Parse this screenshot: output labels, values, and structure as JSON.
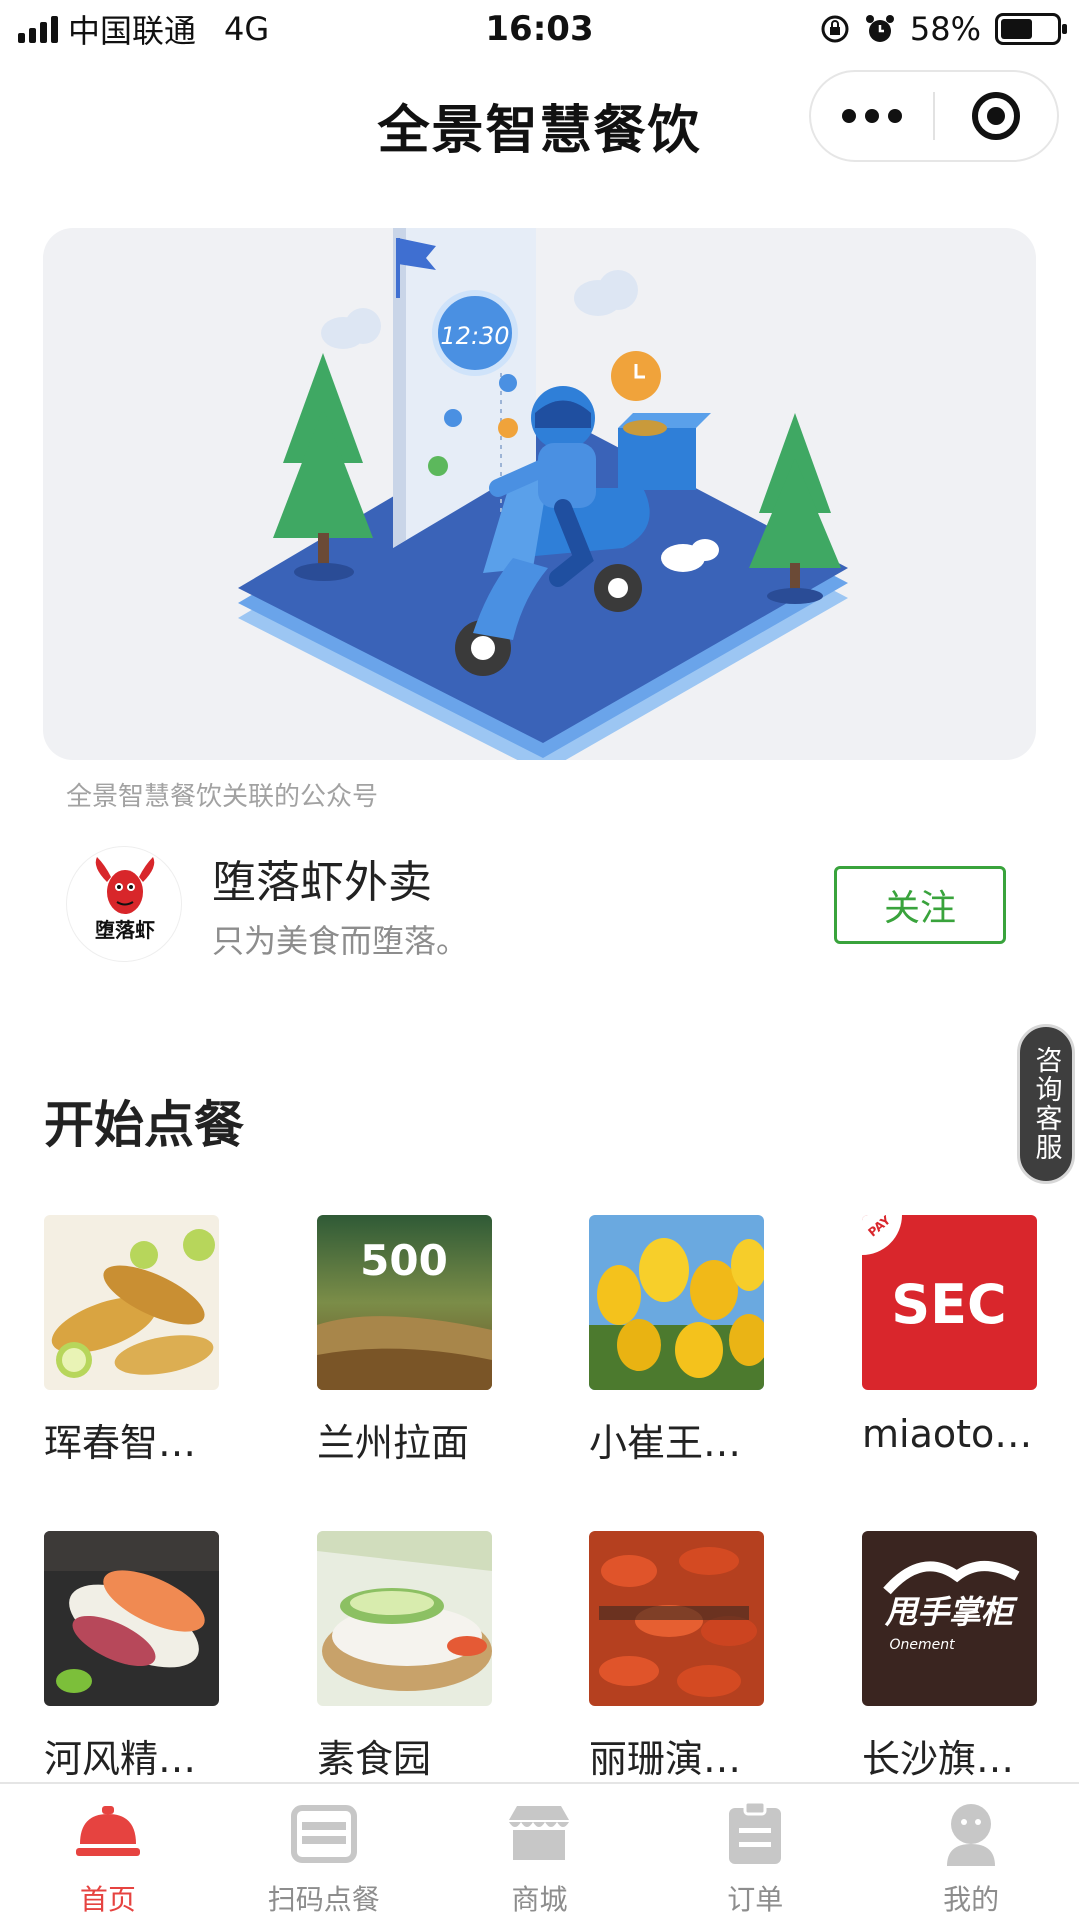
{
  "status_bar": {
    "carrier": "中国联通",
    "network": "4G",
    "time": "16:03",
    "battery": "58%",
    "battery_level": 0.58
  },
  "navbar": {
    "title": "全景智慧餐饮"
  },
  "banner": {
    "clock_text": "12:30"
  },
  "official_account": {
    "caption": "全景智慧餐饮关联的公众号",
    "name": "堕落虾外卖",
    "description": "只为美食而堕落。",
    "follow_label": "关注",
    "logo_text": "堕落虾"
  },
  "consult_label": "咨询客服",
  "section_title": "开始点餐",
  "shops": [
    {
      "name": "珲春智…",
      "thumb_text": ""
    },
    {
      "name": "兰州拉面",
      "thumb_text": "500"
    },
    {
      "name": "小崔王…",
      "thumb_text": ""
    },
    {
      "name": "miaoto…",
      "thumb_text": "SEC",
      "thumb_badge": "PAY"
    },
    {
      "name": "河风精…",
      "thumb_text": ""
    },
    {
      "name": "素食园",
      "thumb_text": ""
    },
    {
      "name": "丽珊演…",
      "thumb_text": ""
    },
    {
      "name": "长沙旗…",
      "thumb_text": "甩手掌柜",
      "thumb_sub": "Onement"
    }
  ],
  "tabs": [
    {
      "label": "首页",
      "icon": "food-cloche-icon",
      "active": true
    },
    {
      "label": "扫码点餐",
      "icon": "scan-icon",
      "active": false
    },
    {
      "label": "商城",
      "icon": "store-icon",
      "active": false
    },
    {
      "label": "订单",
      "icon": "order-clipboard-icon",
      "active": false
    },
    {
      "label": "我的",
      "icon": "user-icon",
      "active": false
    }
  ],
  "colors": {
    "accent_green": "#39a33c",
    "active_red": "#e64340",
    "inactive_gray": "#8d8d8d"
  }
}
